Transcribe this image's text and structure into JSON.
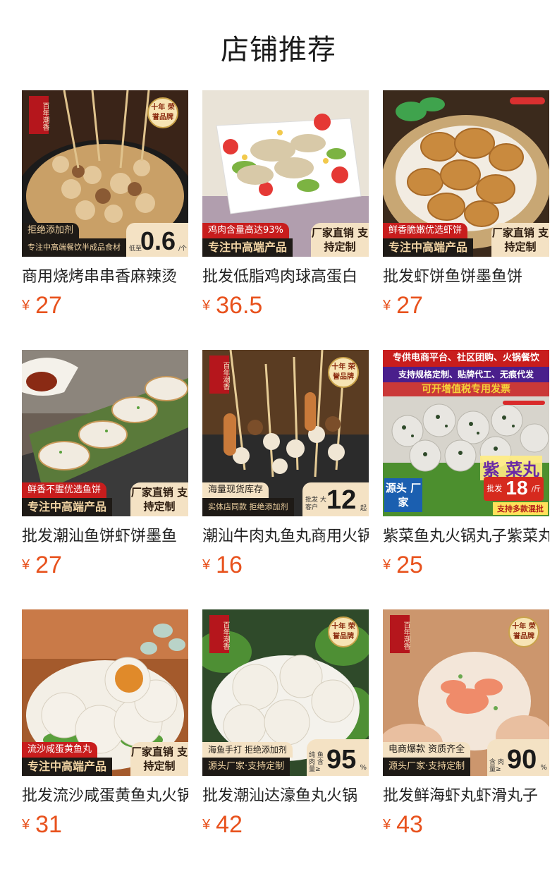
{
  "page": {
    "title": "店铺推荐"
  },
  "products": [
    {
      "title": "商用烧烤串串香麻辣烫",
      "price": "27",
      "currency": "¥",
      "badges": {
        "top": "拒绝添加剂",
        "left": "专注中高端餐饮半成品食材",
        "tag_prefix": "低至",
        "tag_value": "0.6",
        "tag_unit": "/个",
        "seal": "十年 荣誉品牌",
        "stamp": "百年潮香"
      }
    },
    {
      "title": "批发低脂鸡肉球高蛋白",
      "price": "36.5",
      "currency": "¥",
      "badges": {
        "top": "鸡肉含量高达93%",
        "left": "专注中高端产品",
        "right": "厂家直销 支持定制"
      }
    },
    {
      "title": "批发虾饼鱼饼墨鱼饼",
      "price": "27",
      "currency": "¥",
      "badges": {
        "top": "鲜香脆嫩优选虾饼",
        "left": "专注中高端产品",
        "right": "厂家直销 支持定制"
      }
    },
    {
      "title": "批发潮汕鱼饼虾饼墨鱼",
      "price": "27",
      "currency": "¥",
      "badges": {
        "top": "鲜香不腥优选鱼饼",
        "left": "专注中高端产品",
        "right": "厂家直销 支持定制"
      }
    },
    {
      "title": "潮汕牛肉丸鱼丸商用火锅",
      "price": "16",
      "currency": "¥",
      "badges": {
        "top": "海量现货库存",
        "left": "实体店同款 拒绝添加剂",
        "tag_prefix": "批发 大客户",
        "tag_value": "12",
        "tag_unit": "起",
        "seal": "十年 荣誉品牌",
        "stamp": "百年潮香"
      }
    },
    {
      "title": "紫菜鱼丸火锅丸子紫菜丸",
      "price": "25",
      "currency": "¥",
      "badges": {
        "banner1": "专供电商平台、社区团购、火锅餐饮",
        "banner2": "支持规格定制、贴牌代工、无痕代发",
        "banner3": "可开增值税专用发票",
        "corner": "源头 厂家",
        "product_name": "紫 菜丸",
        "tag_prefix": "批发",
        "tag_value": "18",
        "tag_unit": "/斤",
        "footer": "支持多款混批"
      }
    },
    {
      "title": "批发流沙咸蛋黄鱼丸火锅",
      "price": "31",
      "currency": "¥",
      "badges": {
        "top": "流沙咸蛋黄鱼丸",
        "left": "专注中高端产品",
        "right": "厂家直销 支持定制"
      }
    },
    {
      "title": "批发潮汕达濠鱼丸火锅",
      "price": "42",
      "currency": "¥",
      "badges": {
        "top": "海鱼手打 拒绝添加剂",
        "left": "源头厂家·支持定制",
        "tag_prefix": "纯 鱼肉 含量≥",
        "tag_value": "95",
        "tag_unit": "%",
        "seal": "十年 荣誉品牌",
        "stamp": "百年潮香"
      }
    },
    {
      "title": "批发鲜海虾丸虾滑丸子",
      "price": "43",
      "currency": "¥",
      "badges": {
        "top": "电商爆款 资质齐全",
        "left": "源头厂家·支持定制",
        "tag_prefix": "含 肉 量≥",
        "tag_value": "90",
        "tag_unit": "%",
        "seal": "十年 荣誉品牌",
        "stamp": "百年潮香"
      }
    }
  ],
  "colors": {
    "price": "#e8521d",
    "ribbon_dark": "#1e1a16",
    "ribbon_red": "#c81d1d",
    "ribbon_cream": "#f4e2c4"
  }
}
